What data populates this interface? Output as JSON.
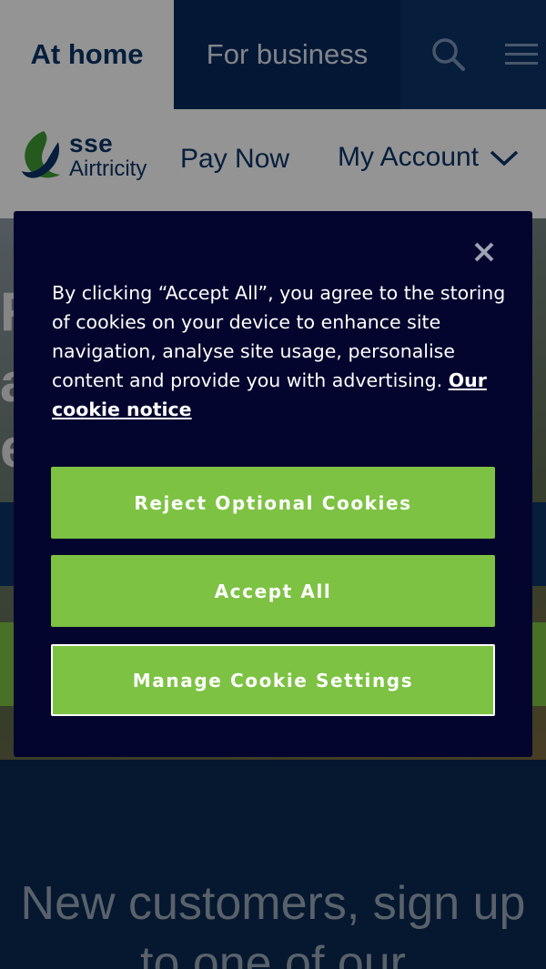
{
  "topbar": {
    "home_tab": "At home",
    "business_tab": "For business",
    "search_icon": "search-icon",
    "menu_icon": "hamburger-menu-icon"
  },
  "navbar": {
    "logo": {
      "brand": "sse",
      "sub": "Airtricity"
    },
    "pay_now": "Pay Now",
    "my_account": "My Account"
  },
  "promo": {
    "heading": "New customers, sign up to one of our"
  },
  "cookie_banner": {
    "message": "By clicking “Accept All”, you agree to the storing of cookies on your device to enhance site navigation, analyse site usage, personalise content and provide you with advertising.",
    "notice_link": "Our cookie notice",
    "reject_label": "Reject Optional Cookies",
    "accept_label": "Accept All",
    "manage_label": "Manage Cookie Settings",
    "close_icon": "close-icon"
  },
  "colors": {
    "brand_navy": "#0b3568",
    "brand_green": "#7dc243",
    "dialog_bg": "#03052e"
  }
}
